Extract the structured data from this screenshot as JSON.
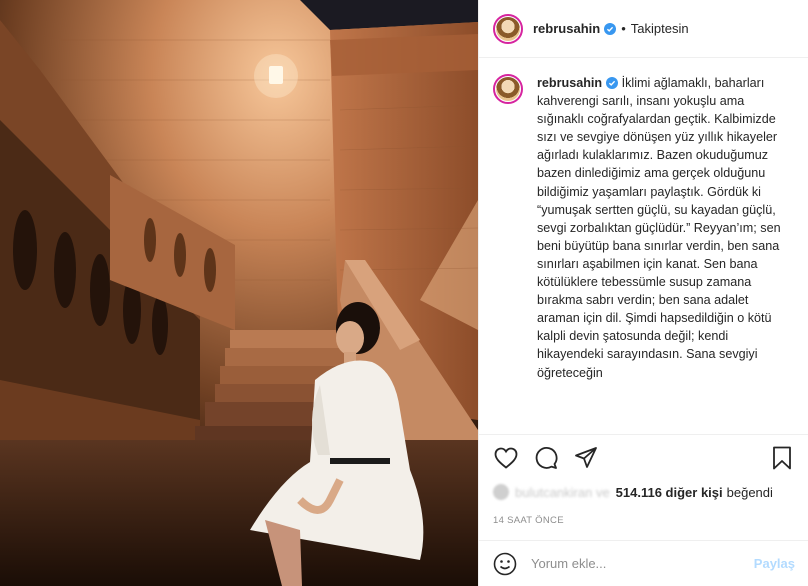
{
  "header": {
    "username": "rebrusahin",
    "dot": "•",
    "follow_status": "Takiptesin"
  },
  "caption": {
    "username": "rebrusahin",
    "text": "İklimi ağlamaklı, baharları kahverengi sarılı, insanı yokuşlu ama sığınaklı coğrafyalardan geçtik. Kalbimizde sızı ve sevgiye dönüşen yüz yıllık hikayeler ağırladı kulaklarımız. Bazen okuduğumuz bazen dinlediğimiz ama gerçek olduğunu bildiğimiz yaşamları paylaştık. Gördük ki “yumuşak sertten güçlü, su kayadan güçlü, sevgi zorbalıktan güçlüdür.” Reyyan’ım; sen beni büyütüp bana sınırlar verdin, ben sana sınırları aşabilmen için kanat. Sen bana kötülüklere tebessümle susup zamana bırakma sabrı verdin; ben sana adalet araman için dil. Şimdi hapsedildiğin o kötü kalpli devin şatosunda değil; kendi hikayendeki sarayındasın. Sana sevgiyi öğreteceğin"
  },
  "likes": {
    "liker_blurred": "bulutcankiran ve",
    "count": "514.116 diğer kişi",
    "suffix": "beğendi"
  },
  "timestamp": "14 SAAT ÖNCE",
  "comment_box": {
    "placeholder": "Yorum ekle...",
    "post_label": "Paylaş"
  },
  "icons": [
    "heart-icon",
    "comment-icon",
    "share-icon",
    "bookmark-icon",
    "emoji-icon",
    "verified-icon"
  ],
  "colors": {
    "verified": "#3897f0",
    "story_ring": "#d6249f",
    "post_disabled": "#b3dbff",
    "muted": "#8e8e8e"
  }
}
